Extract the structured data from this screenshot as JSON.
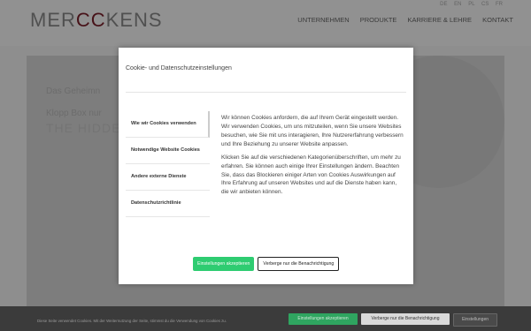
{
  "site": {
    "logo_text_1": "MER",
    "logo_text_2": "C",
    "logo_text_3": "KENS",
    "languages": [
      "DE",
      "EN",
      "PL",
      "CS",
      "FR"
    ],
    "nav": [
      "UNTERNEHMEN",
      "PRODUKTE",
      "KARRIERE & LEHRE",
      "KONTAKT"
    ],
    "hero_line1": "Das Geheimn",
    "hero_line2": "Klopp Box nur",
    "hero_line3": "THE HIDDEN"
  },
  "modal": {
    "title": "Cookie- und Datenschutzeinstellungen",
    "tabs": [
      "Wie wir Cookies verwenden",
      "Notwendige Website Cookies",
      "Andere externe Dienste",
      "Datenschutzrichtlinie"
    ],
    "paragraph1": "Wir können Cookies anfordern, die auf Ihrem Gerät eingestellt werden. Wir verwenden Cookies, um uns mitzuteilen, wenn Sie unsere Websites besuchen, wie Sie mit uns interagieren, Ihre Nutzererfahrung verbessern und Ihre Beziehung zu unserer Website anpassen.",
    "paragraph2": "Klicken Sie auf die verschiedenen Kategorienüberschriften, um mehr zu erfahren. Sie können auch einige Ihrer Einstellungen ändern. Beachten Sie, dass das Blockieren einiger Arten von Cookies Auswirkungen auf Ihre Erfahrung auf unseren Websites und auf die Dienste haben kann, die wir anbieten können.",
    "accept_label": "Einstellungen akzeptieren",
    "hide_label": "Verberge nur die Benachrichtigung"
  },
  "cookiebar": {
    "message": "Diese Seite verwendet Cookies. Mit der Weiternutzung der Seite, stimmst du die Verwendung von Cookies zu.",
    "accept_label": "Einstellungen akzeptieren",
    "hide_label": "Verberge nur die Benachrichtigung",
    "settings_label": "Einstellungen"
  },
  "colors": {
    "accent_green": "#2ecc71",
    "logo_accent": "#7a1f2a"
  }
}
